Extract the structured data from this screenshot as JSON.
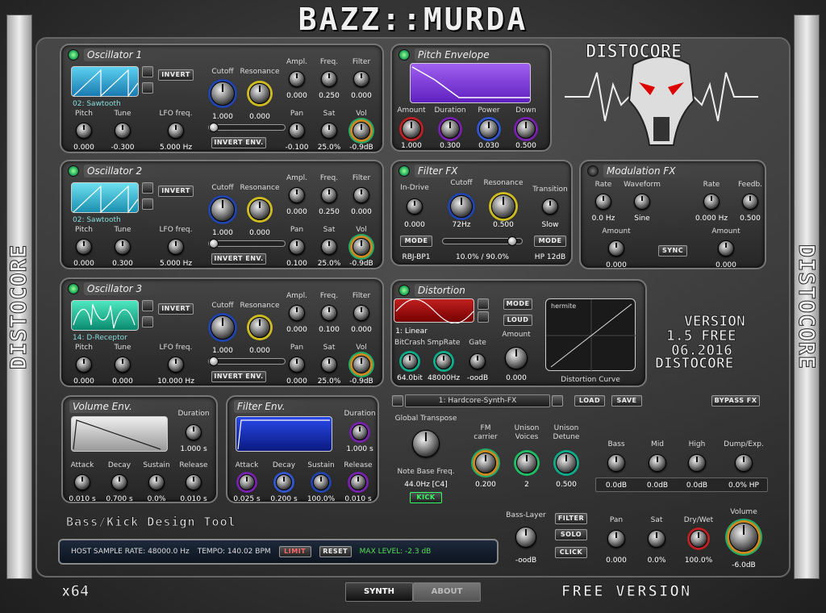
{
  "app": {
    "title": "BAZZ::MURDA",
    "side_left": "DISTOCORE",
    "side_right": "DISTOCORE",
    "brand": "DISTOCORE",
    "version_lines": [
      "VERSION",
      "1.5 FREE",
      "06.2016",
      "DISTOCORE"
    ],
    "tagline": "Bass/Kick Design Tool",
    "arch": "x64",
    "free_version": "FREE VERSION"
  },
  "colors": {
    "accent_cyan": "#4cc8e8",
    "accent_green": "#3c6",
    "accent_purple": "#8a2be2",
    "accent_blue": "#1e3cc8",
    "accent_red": "#c22"
  },
  "oscillators": [
    {
      "title": "Oscillator 1",
      "invert": "INVERT",
      "invert_env": "INVERT ENV.",
      "waveform": "02: Sawtooth",
      "labels": {
        "cutoff": "Cutoff",
        "resonance": "Resonance",
        "ampl": "Ampl.",
        "freq": "Freq.",
        "filter": "Filter",
        "pitch": "Pitch",
        "tune": "Tune",
        "lfo": "LFO freq.",
        "pan": "Pan",
        "sat": "Sat",
        "vol": "Vol"
      },
      "values": {
        "cutoff": "1.000",
        "resonance": "0.000",
        "ampl": "0.000",
        "freq": "0.250",
        "filter": "0.000",
        "pitch": "0.000",
        "tune": "-0.300",
        "lfo": "5.000 Hz",
        "pan": "-0.100",
        "sat": "25.0%",
        "vol": "-0.9dB"
      }
    },
    {
      "title": "Oscillator 2",
      "invert": "INVERT",
      "invert_env": "INVERT ENV.",
      "waveform": "02: Sawtooth",
      "labels": {
        "cutoff": "Cutoff",
        "resonance": "Resonance",
        "ampl": "Ampl.",
        "freq": "Freq.",
        "filter": "Filter",
        "pitch": "Pitch",
        "tune": "Tune",
        "lfo": "LFO freq.",
        "pan": "Pan",
        "sat": "Sat",
        "vol": "Vol"
      },
      "values": {
        "cutoff": "1.000",
        "resonance": "0.000",
        "ampl": "0.000",
        "freq": "0.250",
        "filter": "0.000",
        "pitch": "0.000",
        "tune": "0.300",
        "lfo": "5.000 Hz",
        "pan": "0.100",
        "sat": "25.0%",
        "vol": "-0.9dB"
      }
    },
    {
      "title": "Oscillator 3",
      "invert": "INVERT",
      "invert_env": "INVERT ENV.",
      "waveform": "14: D-Receptor",
      "labels": {
        "cutoff": "Cutoff",
        "resonance": "Resonance",
        "ampl": "Ampl.",
        "freq": "Freq.",
        "filter": "Filter",
        "pitch": "Pitch",
        "tune": "Tune",
        "lfo": "LFO freq.",
        "pan": "Pan",
        "sat": "Sat",
        "vol": "Vol"
      },
      "values": {
        "cutoff": "1.000",
        "resonance": "0.000",
        "ampl": "0.000",
        "freq": "0.100",
        "filter": "0.000",
        "pitch": "0.000",
        "tune": "0.000",
        "lfo": "10.000 Hz",
        "pan": "0.000",
        "sat": "25.0%",
        "vol": "-0.9dB"
      }
    }
  ],
  "pitch_env": {
    "title": "Pitch Envelope",
    "labels": [
      "Amount",
      "Duration",
      "Power",
      "Down"
    ],
    "values": [
      "1.000",
      "0.300",
      "0.030",
      "0.500"
    ]
  },
  "filter_fx": {
    "title": "Filter FX",
    "labels": [
      "In-Drive",
      "Cutoff",
      "Resonance",
      "Transition"
    ],
    "values": [
      "0.000",
      "72Hz",
      "0.500",
      "Slow"
    ],
    "mode_left": "MODE",
    "mode_right": "MODE",
    "filter_type": "RBJ-BP1",
    "mix": "10.0% / 90.0%",
    "filter_slope": "HP 12dB"
  },
  "modulation_fx": {
    "title": "Modulation FX",
    "rate1_label": "Rate",
    "waveform_label": "Waveform",
    "rate2_label": "Rate",
    "feedb_label": "Feedb.",
    "rate1": "0.0 Hz",
    "waveform": "Sine",
    "rate2": "0.000 Hz",
    "feedb": "0.500",
    "amount1_label": "Amount",
    "amount2_label": "Amount",
    "amount1": "0.000",
    "amount2": "0.000",
    "sync": "SYNC"
  },
  "distortion": {
    "title": "Distortion",
    "mode": "MODE",
    "loud": "LOUD",
    "type": "1: Linear",
    "curve_type": "hermite",
    "curve_label": "Distortion Curve",
    "labels": [
      "BitCrash",
      "SmpRate",
      "Gate",
      "Amount"
    ],
    "values": [
      "64.0bit",
      "48000Hz",
      "-oodB",
      "0.000"
    ]
  },
  "preset": {
    "name": "1: Hardcore-Synth-FX",
    "load": "LOAD",
    "save": "SAVE",
    "bypass": "BYPASS FX"
  },
  "volume_env": {
    "title": "Volume Env.",
    "duration_label": "Duration",
    "duration": "1.000 s",
    "labels": [
      "Attack",
      "Decay",
      "Sustain",
      "Release"
    ],
    "values": [
      "0.010 s",
      "0.700 s",
      "0.0%",
      "0.010 s"
    ]
  },
  "filter_env": {
    "title": "Filter Env.",
    "duration_label": "Duration",
    "duration": "1.000 s",
    "labels": [
      "Attack",
      "Decay",
      "Sustain",
      "Release"
    ],
    "values": [
      "0.025 s",
      "0.200 s",
      "100.0%",
      "0.010 s"
    ]
  },
  "global": {
    "transpose_label": "Global Transpose",
    "base_label": "Note Base Freq.",
    "base_value": "44.0Hz [C4]",
    "kick": "KICK",
    "fm_label": "FM\ncarrier",
    "fm_value": "0.200",
    "uv_label": "Unison\nVoices",
    "uv_value": "2",
    "ud_label": "Unison\nDetune",
    "ud_value": "0.500"
  },
  "eq": {
    "labels": [
      "Bass",
      "Mid",
      "High",
      "Dump/Exp."
    ],
    "values": [
      "0.0dB",
      "0.0dB",
      "0.0dB",
      "0.0% HP"
    ]
  },
  "master": {
    "bass_layer_label": "Bass-Layer",
    "bass_layer_value": "-oodB",
    "filter": "FILTER",
    "solo": "SOLO",
    "click": "CLICK",
    "labels": [
      "Pan",
      "Sat",
      "Dry/Wet",
      "Volume"
    ],
    "values": [
      "0.000",
      "0.0%",
      "100.0%",
      "-6.0dB"
    ]
  },
  "status": {
    "sample_rate": "HOST SAMPLE RATE: 48000.0 Hz",
    "tempo": "TEMPO: 140.02 BPM",
    "limit": "LIMIT",
    "reset": "RESET",
    "max_level": "MAX LEVEL: -2.3 dB"
  },
  "tabs": {
    "synth": "SYNTH",
    "about": "ABOUT"
  }
}
